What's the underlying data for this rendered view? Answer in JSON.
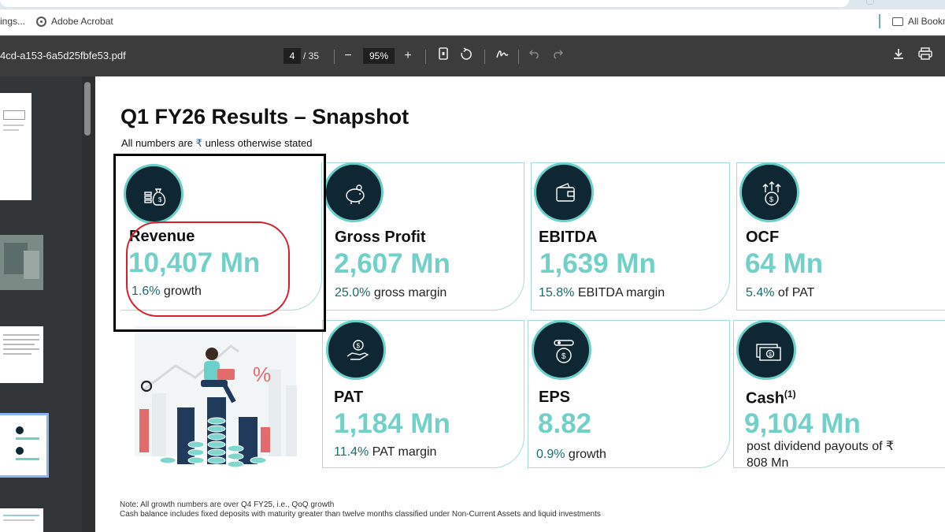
{
  "browser": {
    "bookmark_truncated": "ings...",
    "bookmark_acrobat": "Adobe Acrobat",
    "bookmark_all": "All Bookm"
  },
  "pdf_viewer": {
    "filename": "4cd-a153-6a5d25fbfe53.pdf",
    "page_current": "4",
    "page_total": "/ 35",
    "zoom": "95%"
  },
  "slide": {
    "title": "Q1 FY26 Results – Snapshot",
    "subtitle_prefix": "All numbers are",
    "subtitle_currency": "₹",
    "subtitle_suffix": "unless otherwise stated",
    "metrics": [
      {
        "label": "Revenue",
        "value": "10,407 Mn",
        "sub_hl": "1.6%",
        "sub_text": "growth"
      },
      {
        "label": "Gross Profit",
        "value": "2,607 Mn",
        "sub_hl": "25.0%",
        "sub_text": "gross margin"
      },
      {
        "label": "EBITDA",
        "value": "1,639 Mn",
        "sub_hl": "15.8%",
        "sub_text": "EBITDA margin"
      },
      {
        "label": "OCF",
        "value": "64 Mn",
        "sub_hl": "5.4%",
        "sub_text": "of PAT"
      },
      {
        "label": "PAT",
        "value": "1,184 Mn",
        "sub_hl": "11.4%",
        "sub_text": "PAT margin"
      },
      {
        "label": "EPS",
        "value": "8.82",
        "sub_hl": "0.9%",
        "sub_text": "growth"
      },
      {
        "label": "Cash",
        "label_sup": "(1)",
        "value": "9,104 Mn",
        "sub_text": "post dividend payouts of ₹ 808 Mn"
      }
    ],
    "notes": [
      "Note: All growth numbers are over Q4 FY25, i.e., QoQ growth",
      "Cash balance includes fixed deposits with maturity greater than twelve months classified under Non-Current Assets and liquid investments"
    ],
    "illustration_percent": "%"
  },
  "colors": {
    "accent_teal": "#71d0c8",
    "icon_dark": "#0e2733",
    "annotation_red": "#d81e2a"
  }
}
